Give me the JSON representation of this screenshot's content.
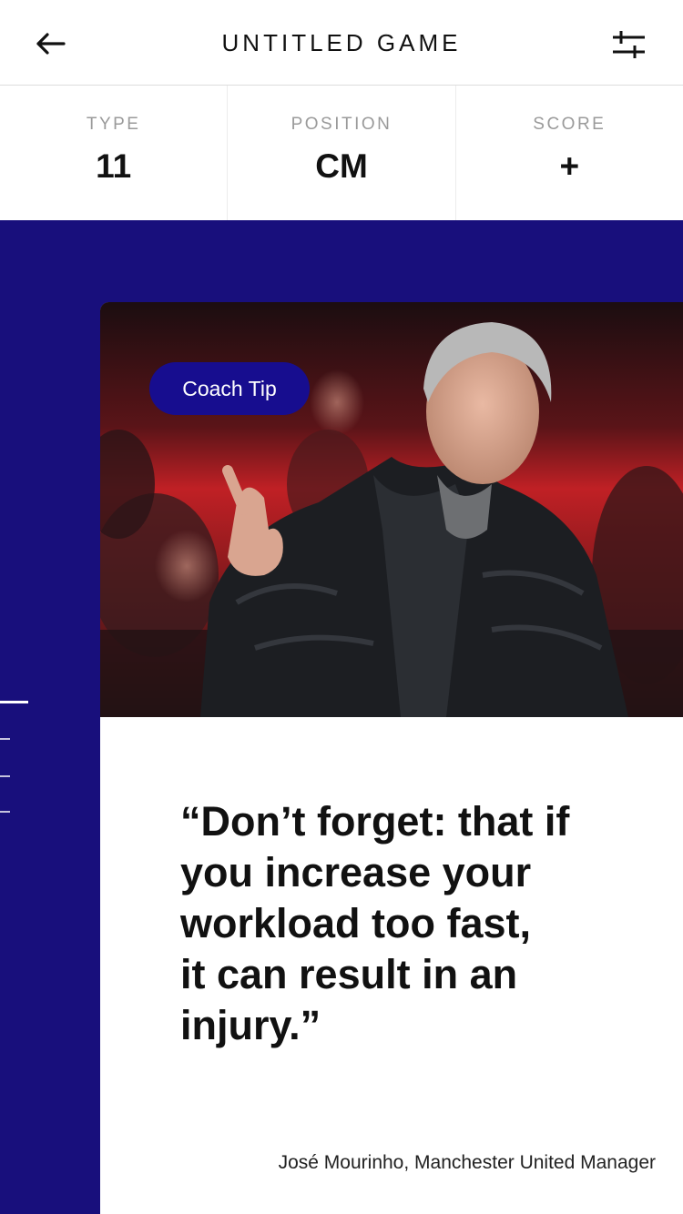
{
  "header": {
    "title": "UNTITLED GAME",
    "back_icon": "arrow-left-icon",
    "filter_icon": "sliders-icon"
  },
  "stats": [
    {
      "label": "TYPE",
      "value": "11"
    },
    {
      "label": "POSITION",
      "value": "CM"
    },
    {
      "label": "SCORE",
      "value": "+"
    }
  ],
  "card": {
    "badge": "Coach Tip",
    "quote": "“Don’t forget: that if\nyou increase your\nworkload too fast,\nit can result in an\ninjury.”",
    "attribution": "José Mourinho, Manchester United Manager"
  },
  "colors": {
    "primary_blue": "#180f7c",
    "badge_blue": "#170d8f",
    "label_gray": "#9a9a9a"
  }
}
